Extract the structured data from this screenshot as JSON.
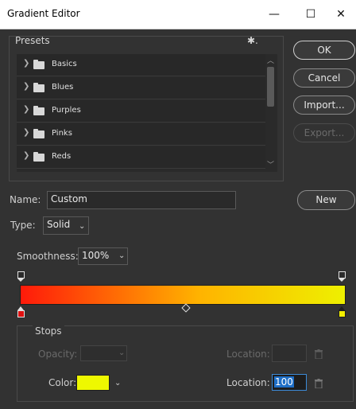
{
  "window": {
    "title": "Gradient Editor",
    "minimize_glyph": "—",
    "maximize_glyph": "☐",
    "close_glyph": "✕"
  },
  "presets": {
    "label": "Presets",
    "gear_icon": "gear-icon",
    "gear_glyph": "✱.",
    "items": [
      {
        "label": "Basics"
      },
      {
        "label": "Blues"
      },
      {
        "label": "Purples"
      },
      {
        "label": "Pinks"
      },
      {
        "label": "Reds"
      }
    ]
  },
  "buttons": {
    "ok": "OK",
    "cancel": "Cancel",
    "import": "Import...",
    "export": "Export...",
    "new": "New"
  },
  "name": {
    "label": "Name:",
    "value": "Custom"
  },
  "type": {
    "label": "Type:",
    "value": "Solid"
  },
  "smoothness": {
    "label": "Smoothness:",
    "value": "100%"
  },
  "gradient": {
    "start_color": "#ff1a0a",
    "mid_color": "#ffb300",
    "end_color": "#eef000",
    "left_stop_color": "#e01010",
    "right_stop_color": "#f2ee00"
  },
  "stops": {
    "label": "Stops",
    "opacity_label": "Opacity:",
    "opacity_location_label": "Location:",
    "color_label": "Color:",
    "color_value": "#eef800",
    "color_location_label": "Location:",
    "color_location_value": "100"
  }
}
